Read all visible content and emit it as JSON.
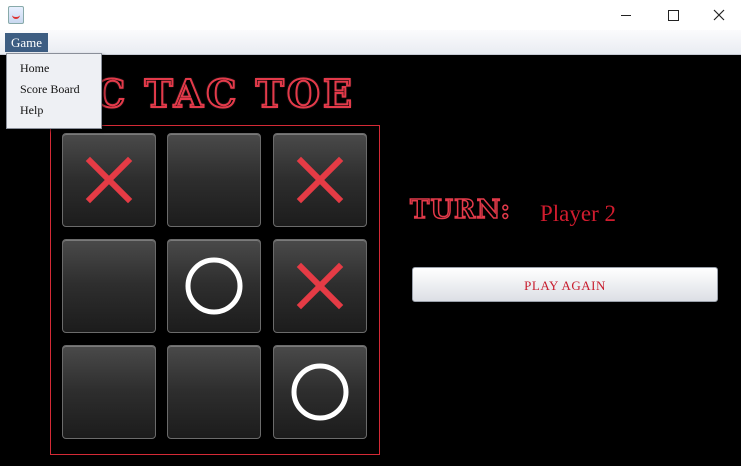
{
  "window": {
    "icons": {
      "app": "java-app-icon",
      "minimize": "minimize-icon",
      "maximize": "maximize-icon",
      "close": "close-icon"
    }
  },
  "menubar": {
    "game_label": "Game"
  },
  "dropdown": {
    "items": [
      "Home",
      "Score Board",
      "Help"
    ]
  },
  "title": "TIC TAC TOE",
  "title_visible": "C TAC TOE",
  "board": {
    "cells": [
      "X",
      "",
      "X",
      "",
      "O",
      "X",
      "",
      "",
      "O"
    ]
  },
  "turn": {
    "label": "TURN:",
    "player": "Player 2"
  },
  "play_again_label": "PLAY AGAIN",
  "colors": {
    "x_mark": "#e53b45",
    "o_mark": "#ffffff",
    "accent": "#d01c2e",
    "menu_active": "#3d5d82"
  }
}
